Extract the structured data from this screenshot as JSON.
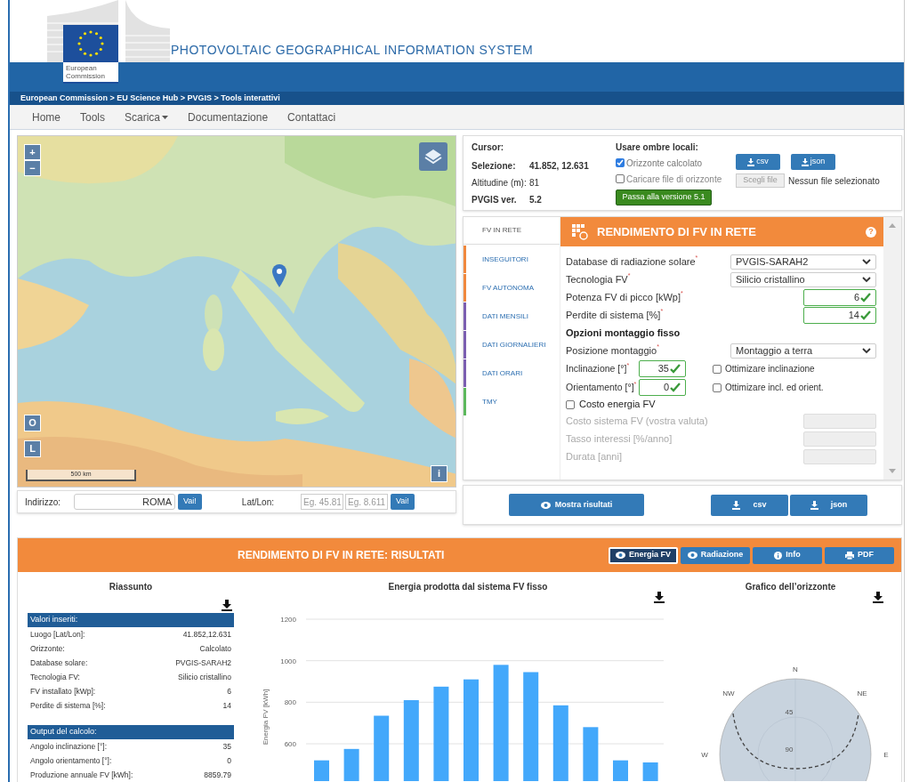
{
  "header": {
    "logo_text": "European Commission",
    "title": "PHOTOVOLTAIC GEOGRAPHICAL INFORMATION SYSTEM",
    "breadcrumb": "European Commission > EU Science Hub > PVGIS > Tools interattivi"
  },
  "nav": [
    {
      "label": "Home",
      "dropdown": false
    },
    {
      "label": "Tools",
      "dropdown": false
    },
    {
      "label": "Scarica",
      "dropdown": true
    },
    {
      "label": "Documentazione",
      "dropdown": false
    },
    {
      "label": "Contattaci",
      "dropdown": false
    }
  ],
  "map": {
    "zoom_in": "+",
    "zoom_out": "−",
    "button_o": "O",
    "button_l": "L",
    "info": "i",
    "scale": "500 km"
  },
  "address": {
    "label": "Indirizzo:",
    "value": "ROMA",
    "go": "Vai!",
    "latlon_label": "Lat/Lon:",
    "lat_placeholder": "Eg. 45.81",
    "lon_placeholder": "Eg. 8.611",
    "go2": "Vai!"
  },
  "info": {
    "cursor": "Cursor:",
    "rows": [
      {
        "label": "Selezione:",
        "value": "41.852, 12.631",
        "bold": true
      },
      {
        "label": "Altitudine (m):",
        "value": "81",
        "bold": false
      },
      {
        "label": "PVGIS ver.",
        "value": "5.2",
        "bold": true
      }
    ],
    "shading_title": "Usare ombre locali:",
    "options": [
      {
        "label": "Orizzonte calcolato",
        "checked": true
      },
      {
        "label": "Caricare file di orizzonte",
        "checked": false
      }
    ],
    "version_button": "Passa alla versione 5.1",
    "download_buttons": [
      "csv",
      "json"
    ],
    "file_button": "Scegli file",
    "file_status": "Nessun file selezionato"
  },
  "tabs": [
    {
      "label": "FV IN RETE",
      "selected": true
    },
    {
      "label": "INSEGUITORI",
      "selected": false,
      "color": "#f0883e"
    },
    {
      "label": "FV AUTONOMA",
      "selected": false,
      "color": "#f0883e"
    },
    {
      "label": "DATI MENSILI",
      "selected": false,
      "color": "#7b5eb0"
    },
    {
      "label": "DATI GIORNALIERI",
      "selected": false,
      "color": "#7b5eb0"
    },
    {
      "label": "DATI ORARI",
      "selected": false,
      "color": "#7b5eb0"
    },
    {
      "label": "TMY",
      "selected": false,
      "color": "#5cb85c"
    }
  ],
  "form": {
    "title": "RENDIMENTO DI FV IN RETE",
    "help": "?",
    "fields": [
      {
        "kind": "select",
        "label": "Database di radiazione solare",
        "required_mark": "*",
        "value": "PVGIS-SARAH2"
      },
      {
        "kind": "select",
        "label": "Tecnologia FV",
        "required_mark": "*",
        "value": "Silicio cristallino"
      },
      {
        "kind": "input",
        "label": "Potenza FV di picco [kWp]",
        "required_mark": "*",
        "value": "6",
        "valid": true
      },
      {
        "kind": "input",
        "label": "Perdite di sistema [%]",
        "required_mark": "*",
        "value": "14",
        "valid": true
      },
      {
        "kind": "heading",
        "label": "Opzioni montaggio fisso"
      },
      {
        "kind": "select",
        "label": "Posizione montaggio",
        "required_mark": "*",
        "value": "Montaggio a terra"
      },
      {
        "kind": "input_option",
        "label": "Inclinazione [°]",
        "required_mark": "*",
        "value": "35",
        "valid": true,
        "option": {
          "label": "Ottimizare inclinazione",
          "checked": false
        }
      },
      {
        "kind": "input_option",
        "label": "Orientamento [°]",
        "required_mark": "*",
        "value": "0",
        "valid": true,
        "option": {
          "label": "Ottimizare incl. ed orient.",
          "checked": false
        }
      },
      {
        "kind": "checkbox",
        "label": "Costo energia FV",
        "checked": false
      },
      {
        "kind": "input",
        "label": "Costo sistema FV (vostra valuta)",
        "disabled": true
      },
      {
        "kind": "input",
        "label": "Tasso interessi [%/anno]",
        "disabled": true
      },
      {
        "kind": "input",
        "label": "Durata [anni]",
        "disabled": true
      }
    ]
  },
  "actions": {
    "show": "Mostra risultati",
    "downloads": [
      "csv",
      "json"
    ]
  },
  "results": {
    "title": "RENDIMENTO DI FV IN RETE: RISULTATI",
    "views": [
      {
        "label": "Energia FV",
        "kind": "eye",
        "selected": true
      },
      {
        "label": "Radiazione",
        "kind": "eye",
        "selected": false
      },
      {
        "label": "Info",
        "kind": "info",
        "selected": false
      },
      {
        "label": "PDF",
        "kind": "print",
        "selected": false
      }
    ],
    "summary": {
      "title": "Riassunto",
      "sections": [
        {
          "title": "Valori inseriti:",
          "rows": [
            [
              "Luogo [Lat/Lon]:",
              "41.852,12.631"
            ],
            [
              "Orizzonte:",
              "Calcolato"
            ],
            [
              "Database solare:",
              "PVGIS-SARAH2"
            ],
            [
              "Tecnologia FV:",
              "Silicio cristallino"
            ],
            [
              "FV installato [kWp]:",
              "6"
            ],
            [
              "Perdite di sistema [%]:",
              "14"
            ]
          ]
        },
        {
          "title": "Output del calcolo:",
          "rows": [
            [
              "Angolo inclinazione [°]:",
              "35"
            ],
            [
              "Angolo orientamento [°]:",
              "0"
            ],
            [
              "Produzione annuale FV [kWh]:",
              "8859.79"
            ]
          ]
        }
      ]
    },
    "energy_chart": {
      "title": "Energia prodotta dal sistema FV fisso",
      "chart_data": {
        "type": "bar",
        "ylabel": "Energia FV [kWh]",
        "yticks": [
          600,
          800,
          1000,
          1200
        ],
        "ylim": [
          420,
          1200
        ],
        "grid": true,
        "values": [
          520,
          575,
          735,
          810,
          875,
          910,
          980,
          945,
          785,
          680,
          520,
          510
        ]
      }
    },
    "horizon": {
      "title": "Grafico dell’orizzonte",
      "labels": [
        "N",
        "NW",
        "NE",
        "W",
        "E",
        "45",
        "90"
      ]
    }
  }
}
